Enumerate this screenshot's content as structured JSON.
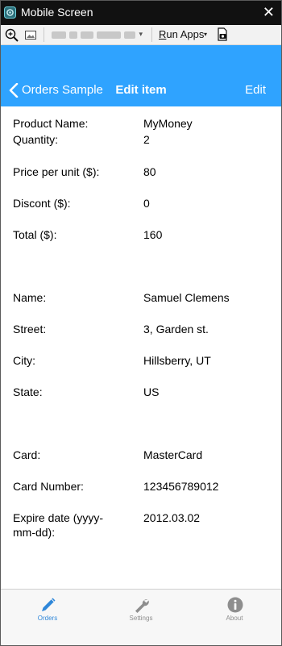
{
  "window": {
    "title": "Mobile Screen",
    "close_glyph": "✕"
  },
  "toolbar": {
    "run_apps_underlined": "R",
    "run_apps_rest": "un Apps",
    "run_caret": "▾",
    "device_caret": "▾"
  },
  "nav": {
    "back_label": "Orders Sample",
    "title": "Edit item",
    "edit_label": "Edit"
  },
  "fields": [
    {
      "label": "Product Name:",
      "value": "MyMoney"
    },
    {
      "label": "Quantity:",
      "value": "2"
    },
    {
      "label": "Price per unit ($):",
      "value": "80"
    },
    {
      "label": "Discont ($):",
      "value": "0"
    },
    {
      "label": "Total ($):",
      "value": "160"
    },
    {
      "label": "Name:",
      "value": "Samuel Clemens"
    },
    {
      "label": "Street:",
      "value": "3, Garden st."
    },
    {
      "label": "City:",
      "value": "Hillsberry, UT"
    },
    {
      "label": "State:",
      "value": "US"
    },
    {
      "label": "Card:",
      "value": "MasterCard"
    },
    {
      "label": "Card Number:",
      "value": "123456789012"
    },
    {
      "label": "Expire date (yyyy-mm-dd):",
      "value": "2012.03.02"
    }
  ],
  "tabs": [
    {
      "label": "Orders",
      "icon": "pencil-icon",
      "active": true
    },
    {
      "label": "Settings",
      "icon": "wrench-icon",
      "active": false
    },
    {
      "label": "About",
      "icon": "info-icon",
      "active": false
    }
  ],
  "colors": {
    "nav_bg": "#2fa3ff",
    "active_tab": "#2f87d9",
    "inactive_tab": "#8e8e8e",
    "titlebar_bg": "#111111"
  }
}
